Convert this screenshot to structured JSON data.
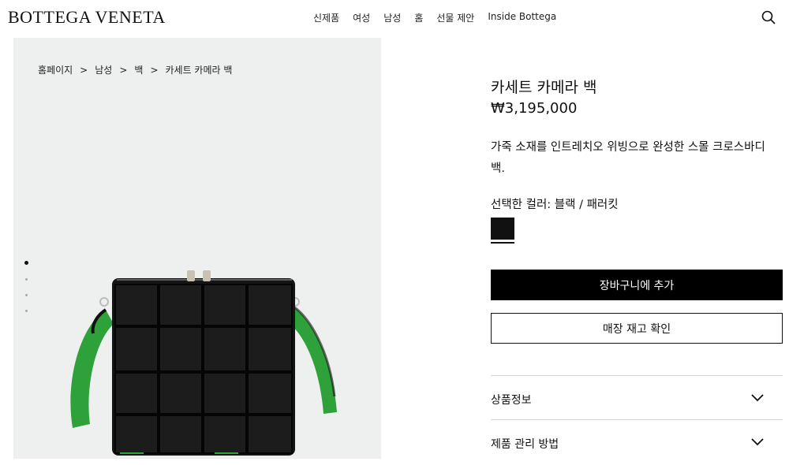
{
  "header": {
    "logo": "BOTTEGA VENETA",
    "nav": [
      "신제품",
      "여성",
      "남성",
      "홈",
      "선물 제안",
      "Inside Bottega"
    ]
  },
  "breadcrumb": [
    "홈페이지",
    "남성",
    "백",
    "카세트 카메라 백"
  ],
  "breadcrumb_separator": ">",
  "gallery": {
    "slide_count": 4,
    "active_slide": 1
  },
  "product": {
    "name": "카세트 카메라 백",
    "price": "₩3,195,000",
    "description": "가죽 소재를 인트레치오 위빙으로 완성한 스몰 크로스바디 백.",
    "color_label": "선택한 컬러: 블랙 / 패러킷",
    "add_to_cart": "장바구니에 추가",
    "check_stock": "매장 재고 확인"
  },
  "accordion": [
    {
      "label": "상품정보"
    },
    {
      "label": "제품 관리 방법"
    }
  ],
  "colors": {
    "swatch": "#111111",
    "strap": "#2fa13a",
    "bag": "#141414",
    "gallery_bg": "#eef0ef"
  }
}
